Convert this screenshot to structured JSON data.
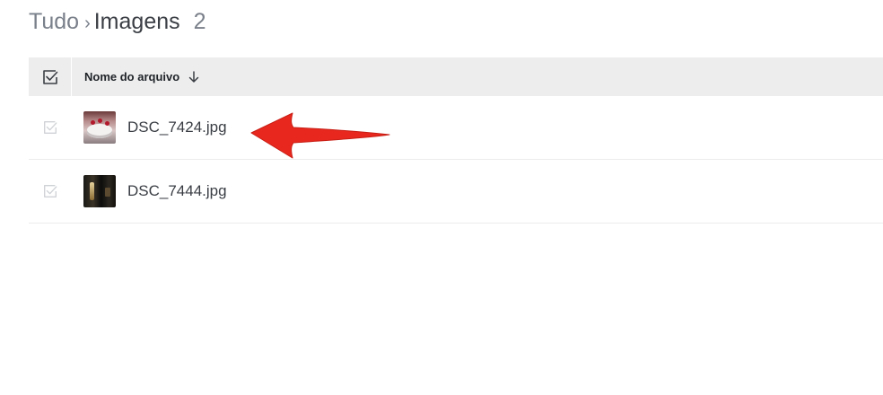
{
  "breadcrumb": {
    "root": "Tudo",
    "separator": "›",
    "current": "Imagens",
    "count": "2"
  },
  "table": {
    "header": {
      "name_label": "Nome do arquivo",
      "sort_icon": "arrow-down-icon",
      "select_all_icon": "checkbox-icon"
    },
    "rows": [
      {
        "name": "DSC_7424.jpg",
        "thumbnail": "cake-photo-thumbnail"
      },
      {
        "name": "DSC_7444.jpg",
        "thumbnail": "dark-photo-thumbnail"
      }
    ]
  },
  "annotation": {
    "icon": "red-arrow-pointer",
    "color": "#e8281e"
  },
  "colors": {
    "header_bg": "#ededed",
    "row_border": "#ececec",
    "text_primary": "#3a3e44",
    "text_muted": "#7a808a"
  }
}
